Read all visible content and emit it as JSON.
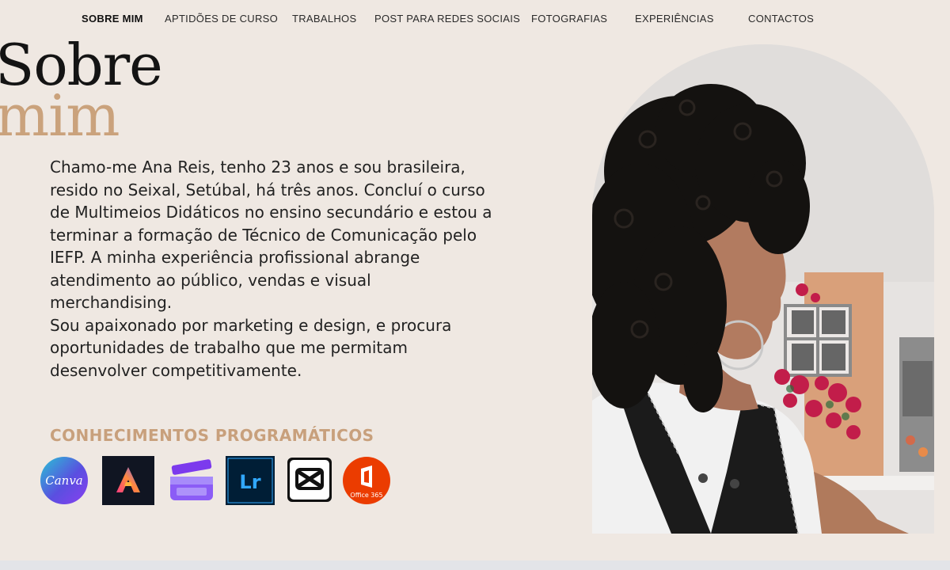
{
  "nav": {
    "items": [
      {
        "label": "SOBRE MIM",
        "active": true
      },
      {
        "label": "APTIDÕES DE CURSO"
      },
      {
        "label": "TRABALHOS"
      },
      {
        "label": "POST PARA REDES SOCIAIS"
      },
      {
        "label": "FOTOGRAFIAS"
      },
      {
        "label": "EXPERIÊNCIAS"
      },
      {
        "label": "CONTACTOS"
      }
    ]
  },
  "hero": {
    "title_line1": "Sobre",
    "title_line2": "mim"
  },
  "bio": {
    "paragraph1": "Chamo-me Ana Reis, tenho 23 anos e sou brasileira, resido no Seixal, Setúbal, há três anos. Concluí o curso de Multimeios Didáticos no ensino secundário e estou a terminar a formação de Técnico de Comunicação pelo IEFP. A minha experiência profissional abrange atendimento ao público, vendas e visual merchandising.",
    "paragraph2": "Sou apaixonado por marketing e design, e procura oportunidades de trabalho que me permitam desenvolver competitivamente."
  },
  "skills": {
    "heading": "CONHECIMENTOS PROGRAMÁTICOS",
    "tools": [
      {
        "name": "Canva",
        "icon": "canva-icon",
        "label": "Canva"
      },
      {
        "name": "Adobe Express",
        "icon": "adobe-express-icon"
      },
      {
        "name": "Clipchamp",
        "icon": "clipchamp-icon"
      },
      {
        "name": "Lightroom",
        "icon": "lightroom-icon",
        "label": "Lr"
      },
      {
        "name": "CapCut",
        "icon": "capcut-icon"
      },
      {
        "name": "Office 365",
        "icon": "office365-icon",
        "label": "Office 365"
      }
    ]
  },
  "colors": {
    "background": "#efe8e2",
    "accent": "#c8a07c",
    "text": "#222222"
  }
}
